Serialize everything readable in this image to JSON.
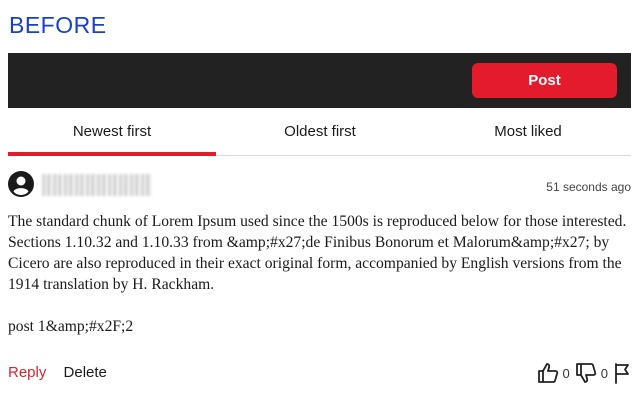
{
  "header_label": "BEFORE",
  "toolbar": {
    "post_label": "Post"
  },
  "tabs": [
    {
      "label": "Newest first",
      "active": true
    },
    {
      "label": "Oldest first",
      "active": false
    },
    {
      "label": "Most liked",
      "active": false
    }
  ],
  "comment": {
    "avatar_icon": "user-circle-icon",
    "timestamp": "51 seconds ago",
    "paragraphs": [
      "The standard chunk of Lorem Ipsum used since the 1500s is reproduced below for those interested. Sections 1.10.32 and 1.10.33 from &amp;#x27;de Finibus Bonorum et Malorum&amp;#x27; by Cicero are also reproduced in their exact original form, accompanied by English versions from the 1914 translation by H. Rackham.",
      "post 1&amp;#x2F;2"
    ],
    "reply_label": "Reply",
    "delete_label": "Delete",
    "likes": "0",
    "dislikes": "0"
  },
  "colors": {
    "accent": "#e31b2d",
    "topbar": "#222222",
    "before_label": "#1a3fd6"
  }
}
